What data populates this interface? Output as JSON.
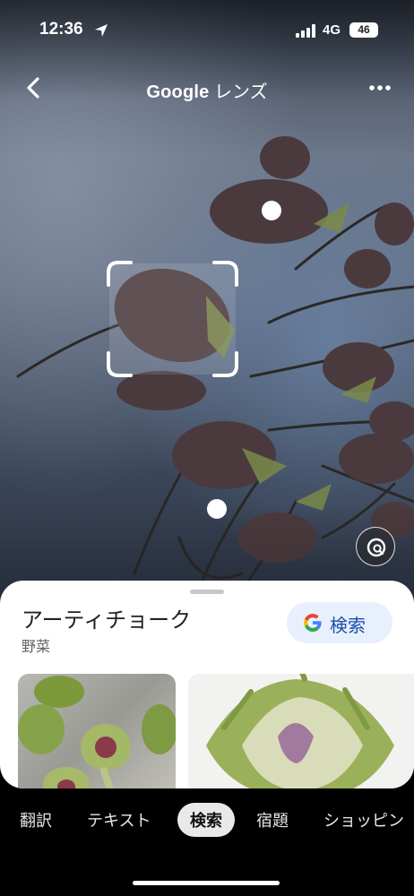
{
  "status_bar": {
    "time": "12:36",
    "network": "4G",
    "battery": "46",
    "icons": [
      "location-arrow-icon",
      "signal-bars-icon"
    ]
  },
  "app_bar": {
    "brand": "Google",
    "title_suffix": " レンズ",
    "icons": [
      "chevron-left-icon",
      "more-horizontal-icon"
    ]
  },
  "result": {
    "title": "アーティチョーク",
    "subtitle": "野菜",
    "search_button": "検索",
    "search_icon": "google-g-icon"
  },
  "tabs": [
    {
      "label": "翻訳",
      "active": false
    },
    {
      "label": "テキスト",
      "active": false
    },
    {
      "label": "検索",
      "active": true
    },
    {
      "label": "宿題",
      "active": false
    },
    {
      "label": "ショッピン",
      "active": false
    }
  ],
  "colors": {
    "chip_bg": "#e8f0fe",
    "chip_text": "#1a4ea8",
    "active_tab_bg": "#e9e9e9"
  }
}
